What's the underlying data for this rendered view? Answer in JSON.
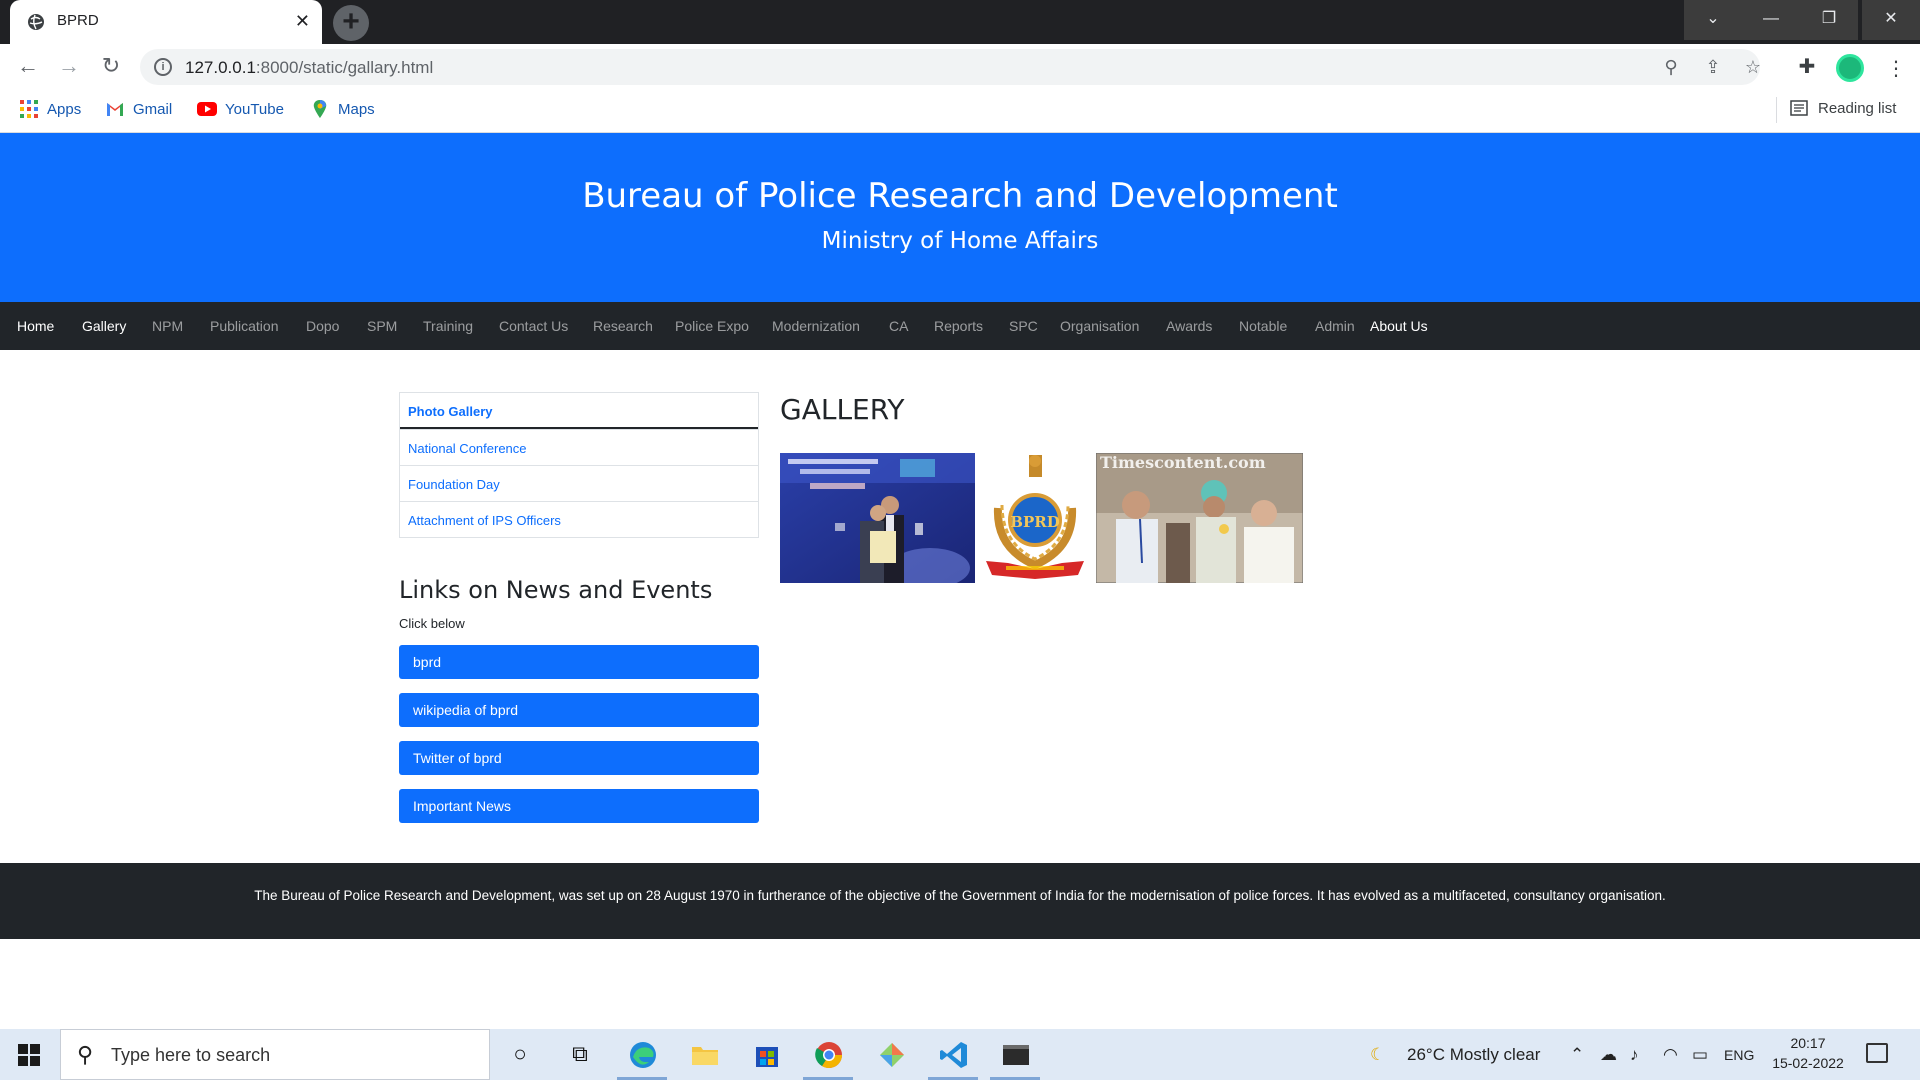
{
  "browser": {
    "tab_title": "BPRD",
    "tab_close": "✕",
    "new_tab": "+",
    "url_host": "127.0.0.1",
    "url_rest": ":8000/static/gallary.html",
    "bookmarks": [
      {
        "label": "Apps",
        "icon": "apps-grid-icon"
      },
      {
        "label": "Gmail",
        "icon": "gmail-icon"
      },
      {
        "label": "YouTube",
        "icon": "youtube-icon"
      },
      {
        "label": "Maps",
        "icon": "maps-pin-icon"
      }
    ],
    "reading_list": "Reading list"
  },
  "header": {
    "title": "Bureau of Police Research and Development",
    "subtitle": "Ministry of Home Affairs"
  },
  "nav": {
    "items": [
      "Home",
      "Gallery",
      "NPM",
      "Publication",
      "Dopo",
      "SPM",
      "Training",
      "Contact Us",
      "Research",
      "Police Expo",
      "Modernization",
      "CA",
      "Reports",
      "SPC",
      "Organisation",
      "Awards",
      "Notable",
      "Admin",
      "About Us"
    ]
  },
  "sidebar": {
    "list": [
      "Photo Gallery",
      "National Conference",
      "Foundation Day",
      "Attachment of IPS Officers"
    ],
    "links_title": "Links on News and Events",
    "click_below": "Click below",
    "buttons": [
      "bprd",
      "wikipedia of bprd",
      "Twitter of bprd",
      "Important News"
    ]
  },
  "gallery": {
    "title": "GALLERY",
    "watermark": "Timescontent.com",
    "logo_text": "BPRD"
  },
  "footer": {
    "text": "The Bureau of Police Research and Development, was set up on 28 August 1970 in furtherance of the objective of the Government of India for the modernisation of police forces. It has evolved as a multifaceted, consultancy organisation."
  },
  "taskbar": {
    "search_placeholder": "Type here to search",
    "weather": "26°C  Mostly clear",
    "lang": "ENG",
    "time": "20:17",
    "date": "15-02-2022"
  },
  "colors": {
    "primary": "#0d6efd",
    "dark": "#212529"
  }
}
